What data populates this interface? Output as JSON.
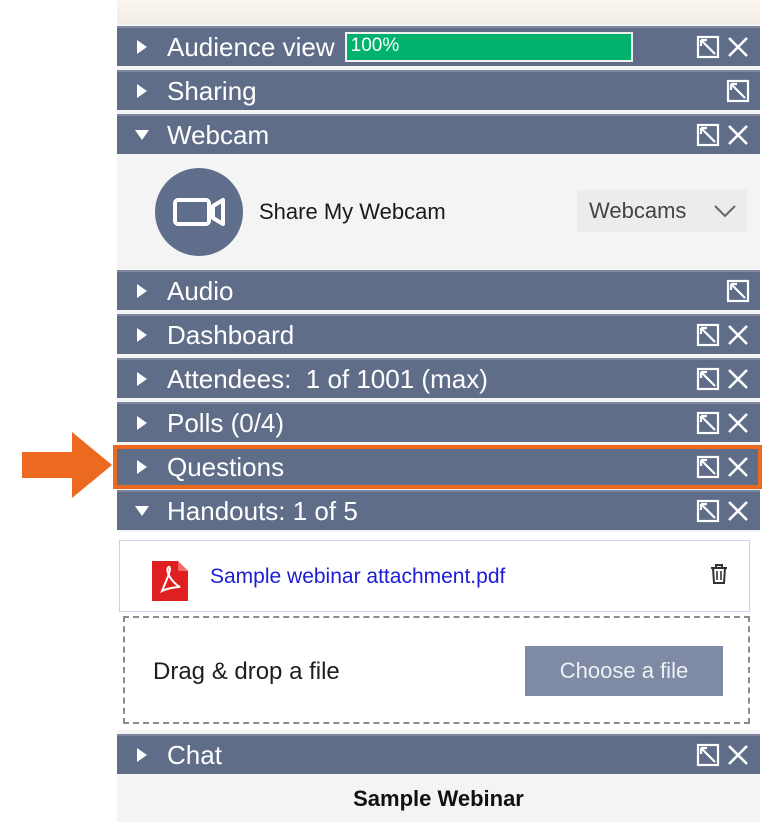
{
  "panels": {
    "audience_view": {
      "title": "Audience view",
      "progress_label": "100%",
      "progress_fraction": 1.0
    },
    "sharing": {
      "title": "Sharing"
    },
    "webcam": {
      "title": "Webcam",
      "share_label": "Share My Webcam",
      "dropdown_value": "Webcams"
    },
    "audio": {
      "title": "Audio"
    },
    "dashboard": {
      "title": "Dashboard"
    },
    "attendees": {
      "title": "Attendees:  1 of 1001 (max)"
    },
    "polls": {
      "title": "Polls (0/4)"
    },
    "questions": {
      "title": "Questions"
    },
    "handouts": {
      "title": "Handouts: 1 of 5",
      "files": [
        {
          "name": "Sample webinar attachment.pdf"
        }
      ],
      "drop_label": "Drag & drop a file",
      "choose_label": "Choose a file"
    },
    "chat": {
      "title": "Chat"
    }
  },
  "footer": {
    "title": "Sample Webinar"
  },
  "colors": {
    "bar_background": "#606d89",
    "progress_fill": "#00b26b",
    "highlight": "#ec6a1f",
    "link": "#1c1cd8",
    "pdf_red": "#e02020"
  },
  "icons": {
    "expand": "triangle-right-icon",
    "collapse": "triangle-down-icon",
    "popout": "popout-icon",
    "close": "close-icon",
    "camera": "video-camera-icon",
    "file": "pdf-file-icon",
    "delete": "trash-icon",
    "pointer": "arrow-right-icon"
  }
}
